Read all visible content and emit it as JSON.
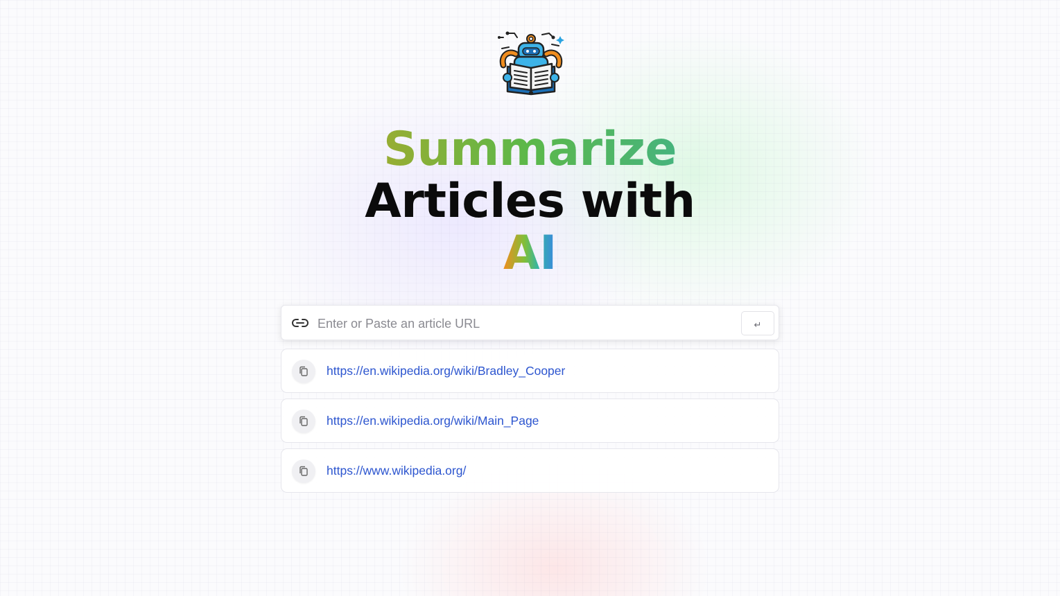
{
  "brand": {
    "logo_icon": "robot-reading-book-icon"
  },
  "hero": {
    "line1": "Summarize",
    "line2": "Articles with",
    "line3": "AI"
  },
  "search": {
    "icon": "link-icon",
    "placeholder": "Enter or Paste an article URL",
    "value": "",
    "submit_label": "↵"
  },
  "history": {
    "items": [
      {
        "url": "https://en.wikipedia.org/wiki/Bradley_Cooper",
        "icon": "copy-icon"
      },
      {
        "url": "https://en.wikipedia.org/wiki/Main_Page",
        "icon": "copy-icon"
      },
      {
        "url": "https://www.wikipedia.org/",
        "icon": "copy-icon"
      }
    ]
  },
  "colors": {
    "link": "#2c55cf",
    "heading": "#0b0b0b",
    "gradient_start": "#f08d1f",
    "gradient_mid": "#5bb84a",
    "gradient_end": "#3b7fe6"
  }
}
